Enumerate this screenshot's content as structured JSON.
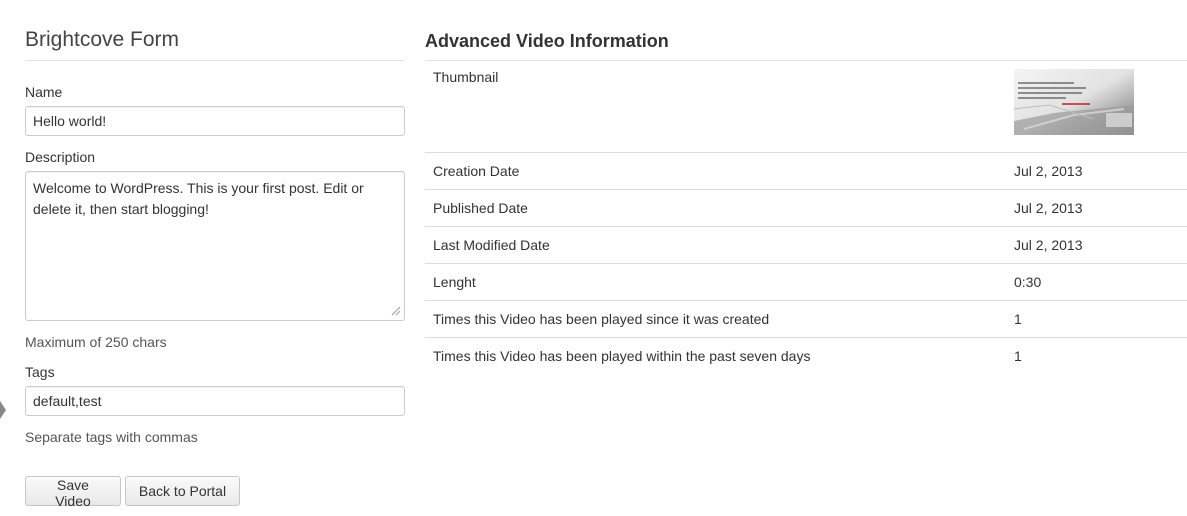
{
  "form": {
    "title": "Brightcove Form",
    "name_label": "Name",
    "name_value": "Hello world!",
    "description_label": "Description",
    "description_value": "Welcome to WordPress. This is your first post. Edit or delete it, then start blogging!",
    "description_help": "Maximum of 250 chars",
    "tags_label": "Tags",
    "tags_value": "default,test",
    "tags_help": "Separate tags with commas",
    "save_button": "Save Video",
    "back_button": "Back to Portal"
  },
  "info": {
    "title": "Advanced Video Information",
    "thumbnail_label": "Thumbnail",
    "rows": [
      {
        "label": "Creation Date",
        "value": "Jul 2, 2013"
      },
      {
        "label": "Published Date",
        "value": "Jul 2, 2013"
      },
      {
        "label": "Last Modified Date",
        "value": "Jul 2, 2013"
      },
      {
        "label": "Lenght",
        "value": "0:30"
      },
      {
        "label": "Times this Video has been played since it was created",
        "value": "1"
      },
      {
        "label": "Times this Video has been played within the past seven days",
        "value": "1"
      }
    ]
  }
}
